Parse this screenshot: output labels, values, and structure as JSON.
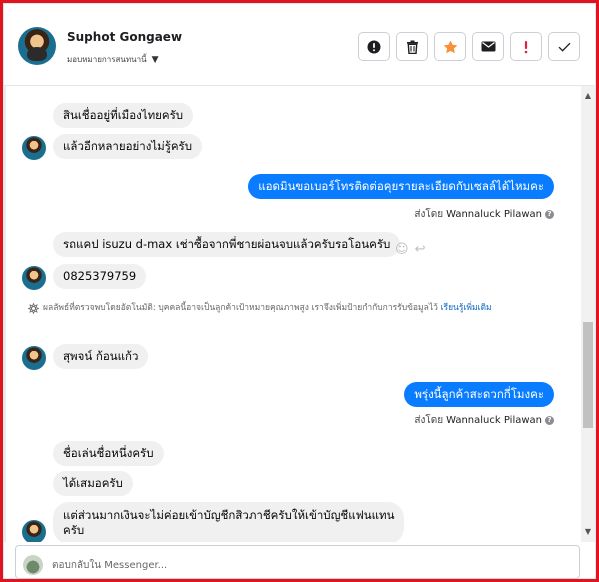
{
  "header": {
    "contact_name": "Suphot Gongaew",
    "assign_label": "มอบหมายการสนทนานี้",
    "actions": [
      {
        "name": "report-spam-button",
        "icon": "exclamation-circle-icon"
      },
      {
        "name": "delete-button",
        "icon": "trash-icon"
      },
      {
        "name": "star-button",
        "icon": "star-icon",
        "color": "#f7923a"
      },
      {
        "name": "mark-unread-button",
        "icon": "envelope-icon"
      },
      {
        "name": "follow-up-button",
        "icon": "exclamation-icon",
        "color": "#e41e3f"
      },
      {
        "name": "mark-done-button",
        "icon": "checkmark-icon"
      }
    ]
  },
  "messages": {
    "m1": "สินเชื่ออยู่ที่เมืองไทยครับ",
    "m2": "แล้วอีกหลายอย่างไม่รู้ครับ",
    "m3": "แอดมินขอเบอร์โทรติดต่อคุยรายละเอียดกับเซลล์ได้ไหมคะ",
    "m4": "รถแคป isuzu d-max เช่าซื้อจากพี่ชายผ่อนจบแล้วครับรอโอนครับ",
    "m5": "0825379759",
    "m6": "สุพจน์     ก้อนแก้ว",
    "m7": "พรุ่งนี้ลูกค้าสะดวกกี่โมงคะ",
    "m8": "ชื่อเล่นชื่อหนึ่งครับ",
    "m9": "ได้เสมอครับ",
    "m10a": "แต่ส่วนมากเงินจะไม่ค่อยเข้าบัญชีกสิวภาชีครับให้เข้าบัญชีแฟนแทน",
    "m10b": "ครับ"
  },
  "sent_by": {
    "prefix": "ส่งโดย",
    "name": "Wannaluck Pilawan"
  },
  "auto_detect": {
    "label": "ผลลัพธ์ที่ตรวจพบโดยอัตโนมัติ:",
    "text": " บุคคลนี้อาจเป็นลูกค้าเป้าหมายคุณภาพสูง เราจึงเพิ่มป้ายกำกับการรับข้อมูลไว้",
    "link": "เรียนรู้เพิ่มเติม"
  },
  "reply": {
    "placeholder": "ตอบกลับใน Messenger..."
  },
  "colors": {
    "outgoing": "#0a7cff",
    "incoming": "#f0f0f0",
    "frame": "#e0141e"
  }
}
